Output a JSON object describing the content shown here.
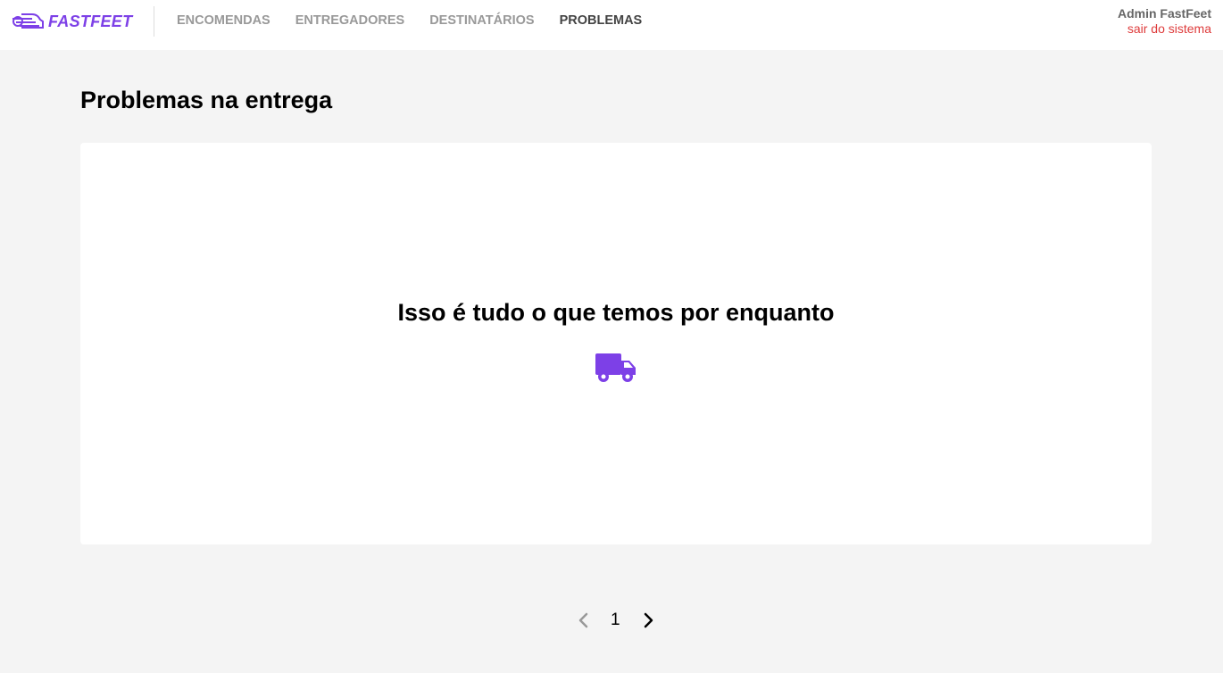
{
  "header": {
    "logo_text": "FASTFEET",
    "nav": [
      {
        "label": "ENCOMENDAS",
        "active": false
      },
      {
        "label": "ENTREGADORES",
        "active": false
      },
      {
        "label": "DESTINATÁRIOS",
        "active": false
      },
      {
        "label": "PROBLEMAS",
        "active": true
      }
    ],
    "user_name": "Admin FastFeet",
    "logout_label": "sair do sistema"
  },
  "main": {
    "title": "Problemas na entrega",
    "empty_message": "Isso é tudo o que temos por enquanto",
    "empty_icon": "truck-icon"
  },
  "pagination": {
    "current_page": "1",
    "prev_icon": "chevron-left-icon",
    "next_icon": "chevron-right-icon"
  },
  "colors": {
    "brand": "#7d40e7",
    "logout": "#de3b3b",
    "nav_inactive": "#999999",
    "nav_active": "#444444",
    "background": "#f4f4f4"
  }
}
